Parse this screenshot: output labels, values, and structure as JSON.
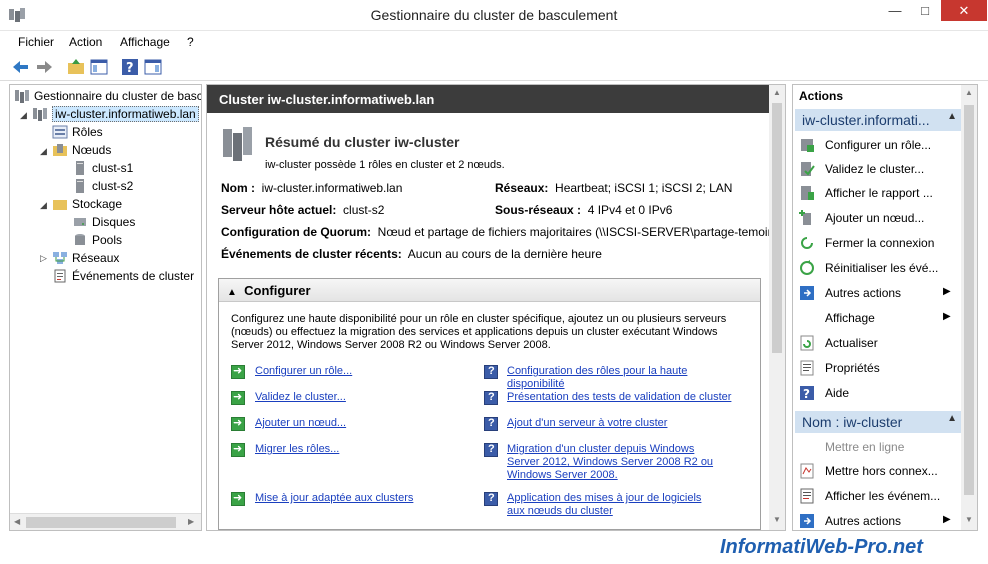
{
  "window": {
    "title": "Gestionnaire du cluster de basculement"
  },
  "menu": [
    "Fichier",
    "Action",
    "Affichage",
    "?"
  ],
  "tree": {
    "root": "Gestionnaire du cluster de basculement",
    "cluster": "iw-cluster.informatiweb.lan",
    "roles": "Rôles",
    "nodes": "Nœuds",
    "node1": "clust-s1",
    "node2": "clust-s2",
    "storage": "Stockage",
    "disks": "Disques",
    "pools": "Pools",
    "networks": "Réseaux",
    "events": "Événements de cluster"
  },
  "center": {
    "header": "Cluster iw-cluster.informatiweb.lan",
    "summary_title": "Résumé du cluster iw-cluster",
    "summary_desc": "iw-cluster possède 1 rôles en cluster et 2 nœuds.",
    "props": {
      "name_label": "Nom :",
      "name_value": "iw-cluster.informatiweb.lan",
      "networks_label": "Réseaux:",
      "networks_value": "Heartbeat; iSCSI 1; iSCSI 2; LAN",
      "host_label": "Serveur hôte actuel:",
      "host_value": "clust-s2",
      "subnets_label": "Sous-réseaux :",
      "subnets_value": "4 IPv4 et 0 IPv6",
      "quorum_label": "Configuration de Quorum:",
      "quorum_value": "Nœud et partage de fichiers majoritaires (\\\\ISCSI-SERVER\\partage-temoin)",
      "events_label": "Événements de cluster récents:",
      "events_value": "Aucun au cours de la dernière heure"
    },
    "configurer": {
      "title": "Configurer",
      "text": "Configurez une haute disponibilité pour un rôle en cluster spécifique, ajoutez un ou plusieurs serveurs (nœuds) ou effectuez la migration des services et applications depuis un cluster exécutant Windows Server 2012, Windows Server 2008 R2 ou Windows Server 2008.",
      "left_links": [
        "Configurer un rôle...",
        "Validez le cluster...",
        "Ajouter un nœud...",
        "Migrer les rôles...",
        "Mise à jour adaptée aux clusters"
      ],
      "right_links": [
        "Configuration des rôles pour la haute disponibilité",
        "Présentation des tests de validation de cluster",
        "Ajout d'un serveur à votre cluster",
        "Migration d'un cluster depuis Windows Server 2012, Windows Server 2008 R2 ou Windows Server 2008.",
        "Application des mises à jour de logiciels aux nœuds du cluster"
      ]
    }
  },
  "actions": {
    "title": "Actions",
    "section1": "iw-cluster.informati...",
    "items1": [
      "Configurer un rôle...",
      "Validez le cluster...",
      "Afficher le rapport ...",
      "Ajouter un nœud...",
      "Fermer la connexion",
      "Réinitialiser les évé...",
      "Autres actions",
      "Affichage",
      "Actualiser",
      "Propriétés",
      "Aide"
    ],
    "section2": "Nom : iw-cluster",
    "items2": [
      "Mettre en ligne",
      "Mettre hors connex...",
      "Afficher les événem...",
      "Autres actions"
    ]
  },
  "watermark": "InformatiWeb-Pro.net",
  "colors": {
    "accent": "#3c3c3c",
    "link": "#1a3fbf",
    "section": "#d1e1f1",
    "close": "#c7372f"
  }
}
